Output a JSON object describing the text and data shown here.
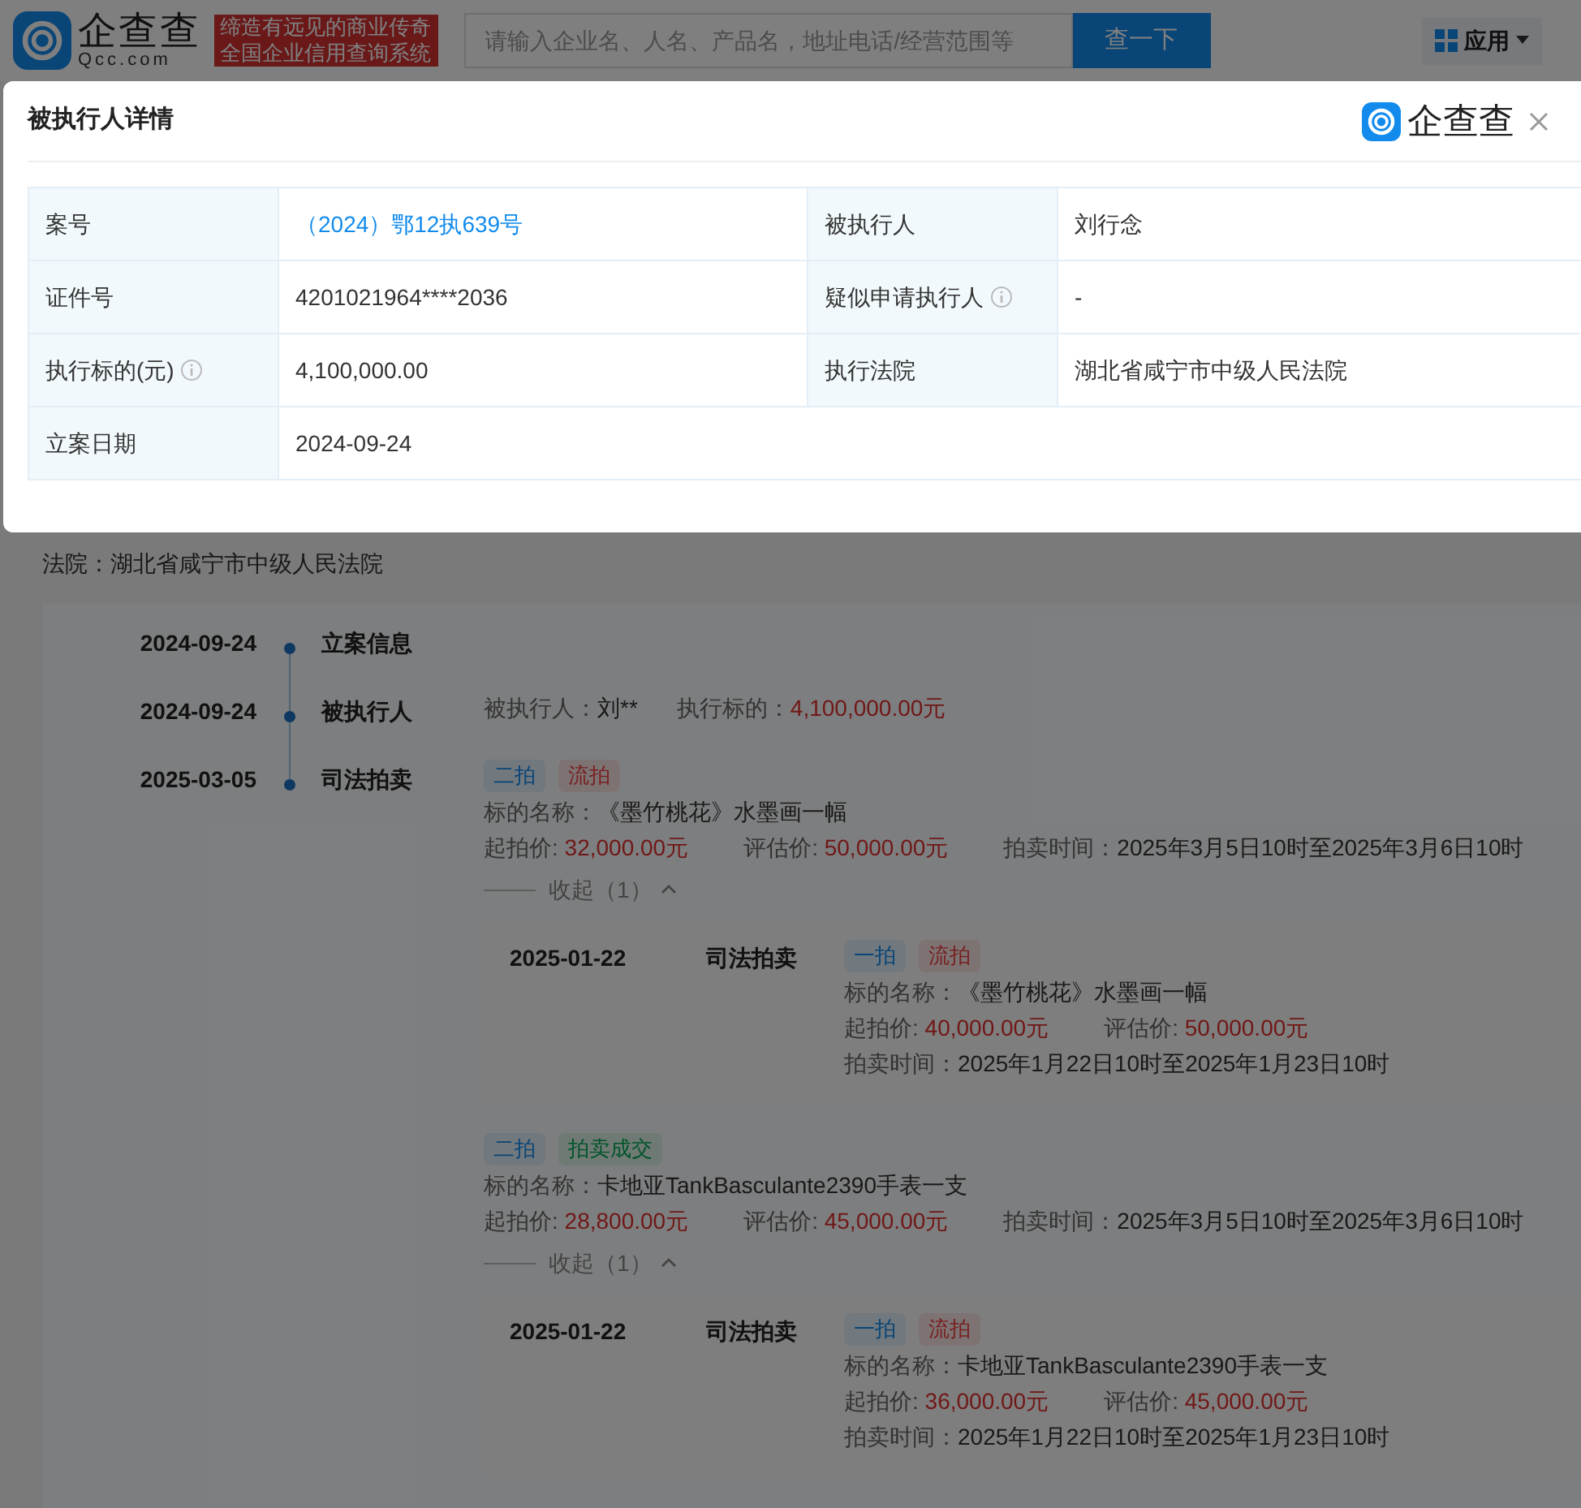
{
  "header": {
    "logo_text": "企查查",
    "logo_sub": "Qcc.com",
    "slogan": [
      "缔造有远见的商业传奇",
      "全国企业信用查询系统"
    ],
    "search": {
      "placeholder": "请输入企业名、人名、产品名，地址电话/经营范围等"
    },
    "search_button": "查一下",
    "app_button": "应用"
  },
  "modal": {
    "title": "被执行人详情",
    "brand": "企查查",
    "rows": [
      [
        {
          "label": "案号",
          "value": "（2024）鄂12执639号",
          "kind": "link"
        },
        {
          "label": "被执行人",
          "value": "刘行念",
          "kind": "text"
        }
      ],
      [
        {
          "label": "证件号",
          "value": "4201021964****2036",
          "kind": "text"
        },
        {
          "label": "疑似申请执行人",
          "value": "-",
          "kind": "text",
          "info": true
        }
      ],
      [
        {
          "label": "执行标的(元)",
          "value": "4,100,000.00",
          "kind": "text",
          "info": true
        },
        {
          "label": "执行法院",
          "value": "湖北省咸宁市中级人民法院",
          "kind": "text"
        }
      ],
      [
        {
          "label": "立案日期",
          "value": "2024-09-24",
          "kind": "text"
        }
      ]
    ]
  },
  "court": "法院：湖北省咸宁市中级人民法院",
  "timeline": [
    {
      "date": "2024-09-24",
      "title": "立案信息",
      "kind": "plain"
    },
    {
      "date": "2024-09-24",
      "title": "被执行人",
      "kind": "fields",
      "fields": [
        {
          "label": "被执行人：",
          "value": "刘**",
          "highlight": false
        },
        {
          "label": "执行标的：",
          "value": "4,100,000.00元",
          "highlight": true
        }
      ]
    },
    {
      "date": "2025-03-05",
      "title": "司法拍卖",
      "kind": "auction",
      "auctions": [
        {
          "tags": [
            {
              "text": "二拍",
              "kind": "round"
            },
            {
              "text": "流拍",
              "kind": "failed"
            }
          ],
          "name_label": "标的名称：",
          "name": "《墨竹桃花》水墨画一幅",
          "start_label": "起拍价:",
          "start": "32,000.00元",
          "eval_label": "评估价:",
          "eval": "50,000.00元",
          "time_label": "拍卖时间：",
          "time": "2025年3月5日10时至2025年3月6日10时",
          "collapse": "收起（1）",
          "expanded": true,
          "history": [
            {
              "date": "2025-01-22",
              "title": "司法拍卖",
              "tags": [
                {
                  "text": "一拍",
                  "kind": "round"
                },
                {
                  "text": "流拍",
                  "kind": "failed"
                }
              ],
              "name_label": "标的名称：",
              "name": "《墨竹桃花》水墨画一幅",
              "start_label": "起拍价:",
              "start": "40,000.00元",
              "eval_label": "评估价:",
              "eval": "50,000.00元",
              "time_label": "拍卖时间：",
              "time": "2025年1月22日10时至2025年1月23日10时"
            }
          ]
        },
        {
          "tags": [
            {
              "text": "二拍",
              "kind": "round"
            },
            {
              "text": "拍卖成交",
              "kind": "sold"
            }
          ],
          "name_label": "标的名称：",
          "name": "卡地亚TankBasculante2390手表一支",
          "start_label": "起拍价:",
          "start": "28,800.00元",
          "eval_label": "评估价:",
          "eval": "45,000.00元",
          "time_label": "拍卖时间：",
          "time": "2025年3月5日10时至2025年3月6日10时",
          "collapse": "收起（1）",
          "expanded": true,
          "history": [
            {
              "date": "2025-01-22",
              "title": "司法拍卖",
              "tags": [
                {
                  "text": "一拍",
                  "kind": "round"
                },
                {
                  "text": "流拍",
                  "kind": "failed"
                }
              ],
              "name_label": "标的名称：",
              "name": "卡地亚TankBasculante2390手表一支",
              "start_label": "起拍价:",
              "start": "36,000.00元",
              "eval_label": "评估价:",
              "eval": "45,000.00元",
              "time_label": "拍卖时间：",
              "time": "2025年1月22日10时至2025年1月23日10时"
            }
          ]
        }
      ]
    }
  ]
}
